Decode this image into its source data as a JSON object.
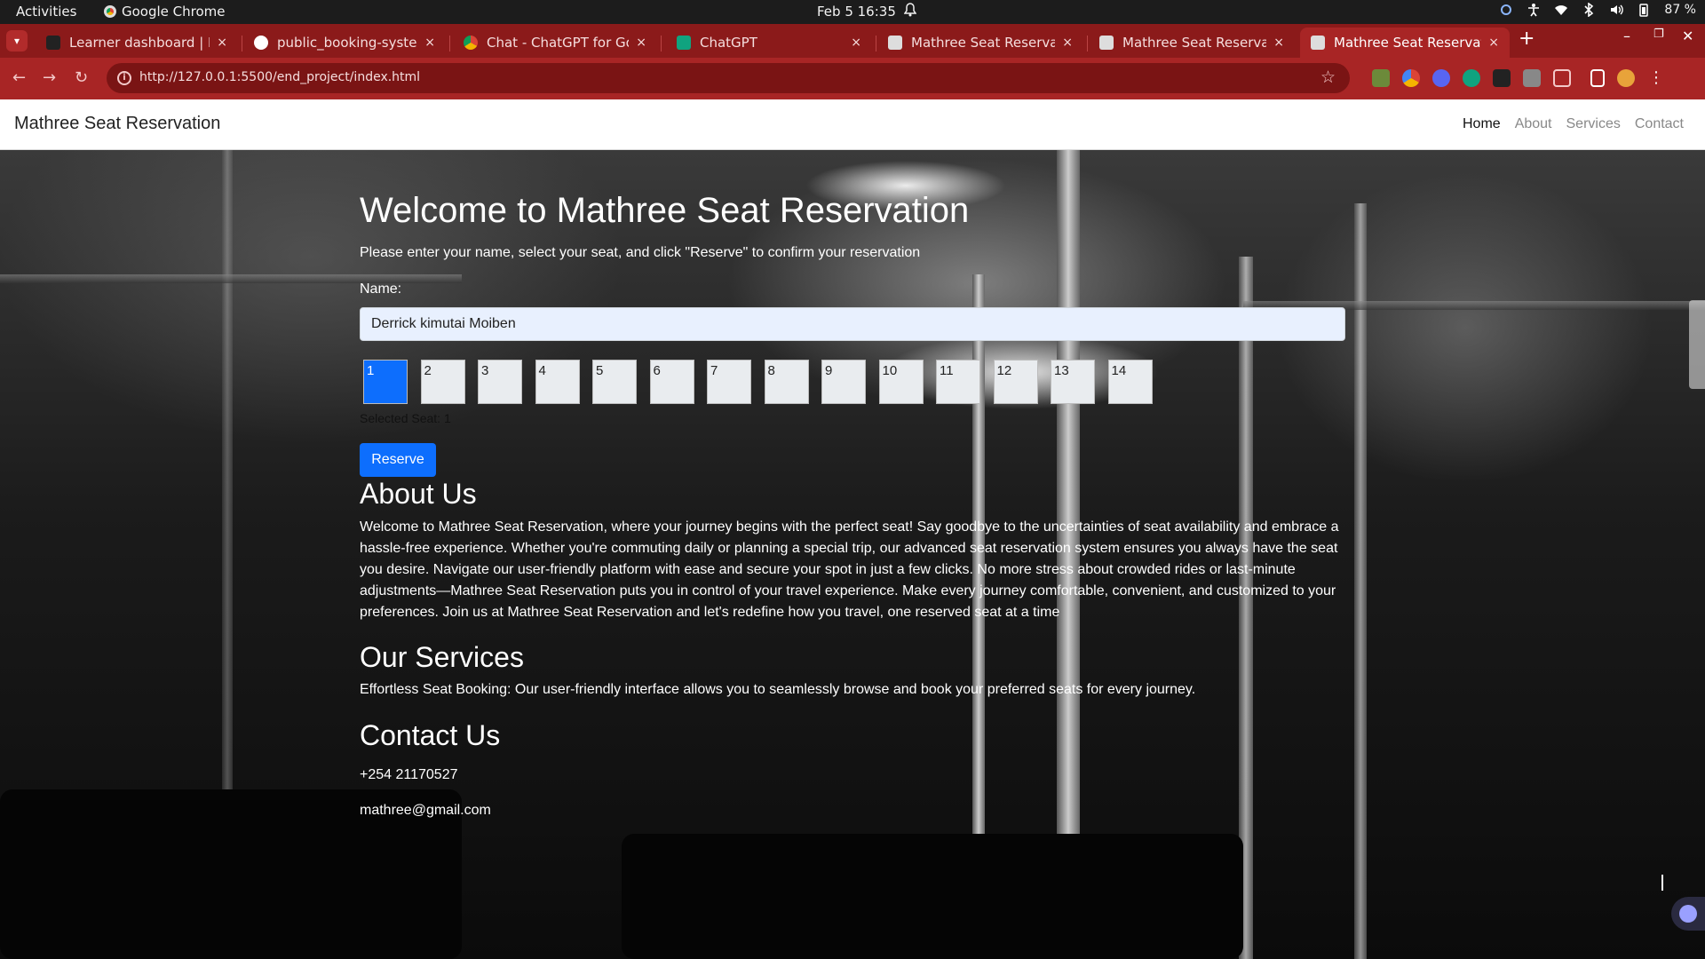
{
  "os": {
    "activities": "Activities",
    "app_name": "Google Chrome",
    "clock": "Feb 5  16:35",
    "battery": "87 %"
  },
  "tabs": [
    {
      "label": "Learner dashboard | Nai",
      "favicon_color": "#222222"
    },
    {
      "label": "public_booking-system/",
      "favicon_color": "#ffffff"
    },
    {
      "label": "Chat - ChatGPT for Goog",
      "favicon_color": "#f4b400"
    },
    {
      "label": "ChatGPT",
      "favicon_color": "#10a37f"
    },
    {
      "label": "Mathree Seat Reservatio",
      "favicon_color": "#dddddd"
    },
    {
      "label": "Mathree Seat Reservatio",
      "favicon_color": "#dddddd"
    },
    {
      "label": "Mathree Seat Reservatio",
      "favicon_color": "#dddddd"
    }
  ],
  "browser": {
    "url": "http://127.0.0.1:5500/end_project/index.html",
    "new_tab": "+",
    "tab_close": "×"
  },
  "site": {
    "brand": "Mathree Seat Reservation",
    "nav": [
      "Home",
      "About",
      "Services",
      "Contact"
    ]
  },
  "booking": {
    "heading": "Welcome to Mathree Seat Reservation",
    "intro": "Please enter your name, select your seat, and click \"Reserve\" to confirm your reservation",
    "name_label": "Name:",
    "name_value": "Derrick kimutai Moiben",
    "seats": [
      "1",
      "2",
      "3",
      "4",
      "5",
      "6",
      "7",
      "8",
      "9",
      "10",
      "11",
      "12",
      "13",
      "14"
    ],
    "selected_seat": "1",
    "selected_text": "Selected Seat: 1",
    "reserve_label": "Reserve"
  },
  "about": {
    "heading": "About Us",
    "text": "Welcome to Mathree Seat Reservation, where your journey begins with the perfect seat! Say goodbye to the uncertainties of seat availability and embrace a hassle-free experience. Whether you're commuting daily or planning a special trip, our advanced seat reservation system ensures you always have the seat you desire. Navigate our user-friendly platform with ease and secure your spot in just a few clicks. No more stress about crowded rides or last-minute adjustments—Mathree Seat Reservation puts you in control of your travel experience. Make every journey comfortable, convenient, and customized to your preferences. Join us at Mathree Seat Reservation and let's redefine how you travel, one reserved seat at a time"
  },
  "services": {
    "heading": "Our Services",
    "text": "Effortless Seat Booking: Our user-friendly interface allows you to seamlessly browse and book your preferred seats for every journey."
  },
  "contact": {
    "heading": "Contact Us",
    "phone": "+254 21170527",
    "email": "mathree@gmail.com"
  },
  "colors": {
    "tab_strip": "#8b1a1a",
    "toolbar": "#a82525",
    "primary_button": "#0d6efd",
    "selected_seat": "#0d6efd"
  }
}
